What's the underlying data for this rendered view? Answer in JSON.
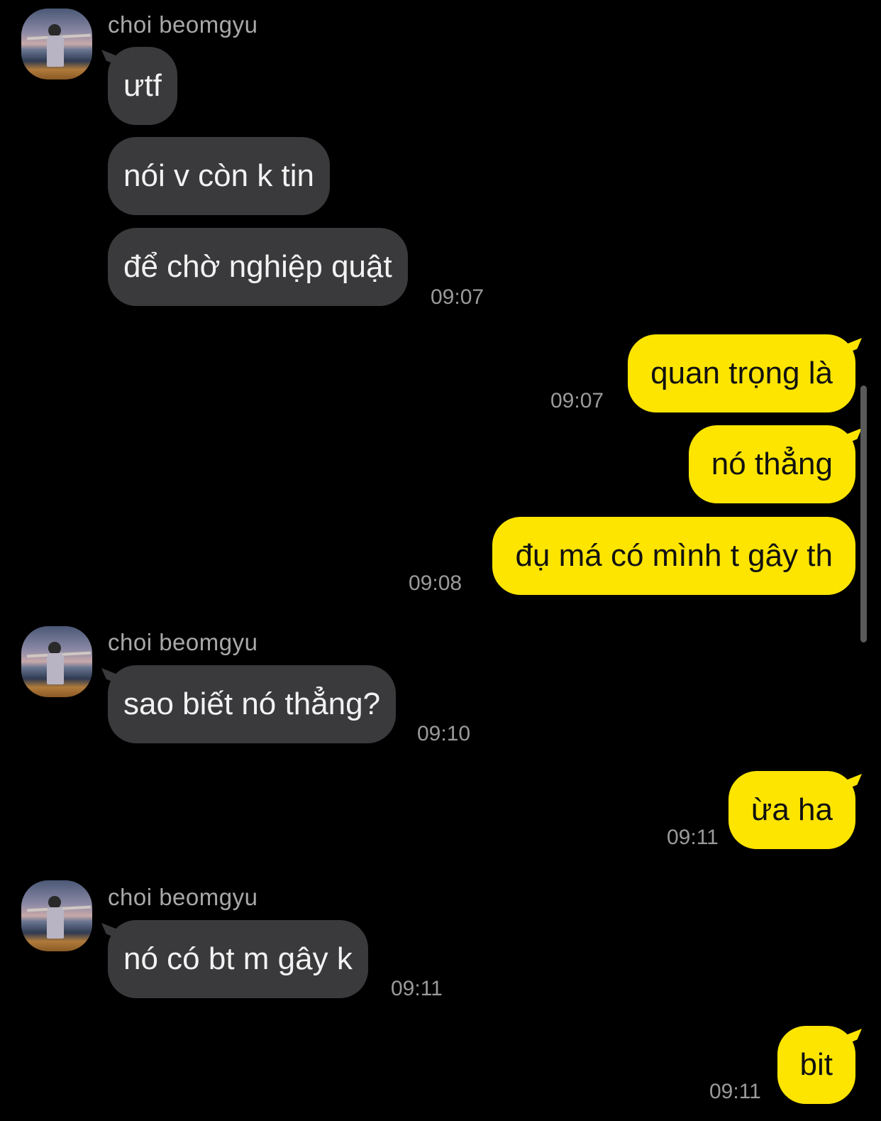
{
  "conversation": {
    "sender_name": "choi beomgyu",
    "groups": [
      {
        "messages": [
          "ưtf",
          "nói v còn k tin",
          "để chờ nghiệp quật"
        ],
        "time": "09:07"
      },
      {
        "messages": [
          "quan trọng là"
        ],
        "time": "09:07"
      },
      {
        "messages": [
          "nó thẳng",
          "đụ má có mình t gây th"
        ],
        "time": "09:08"
      },
      {
        "messages": [
          "sao biết nó thẳng?"
        ],
        "time": "09:10"
      },
      {
        "messages": [
          "ừa ha"
        ],
        "time": "09:11"
      },
      {
        "messages": [
          "nó có bt m gây k"
        ],
        "time": "09:11"
      },
      {
        "messages": [
          "bit"
        ],
        "time": "09:11"
      }
    ]
  },
  "colors": {
    "background": "#000000",
    "incoming_bubble": "#3a3a3c",
    "outgoing_bubble": "#fee500",
    "timestamp": "#9a9a9a"
  },
  "icons": {
    "avatar": "profile-photo-beach"
  }
}
